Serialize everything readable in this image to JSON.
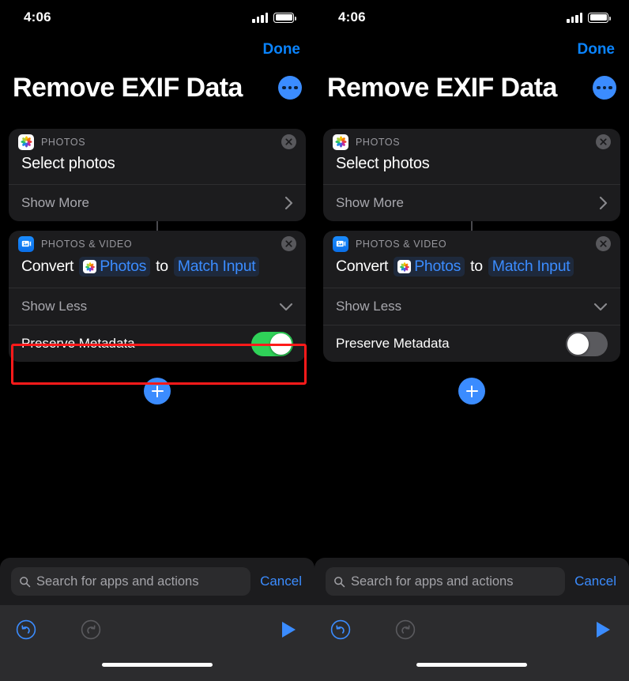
{
  "status_bar": {
    "time": "4:06",
    "signal_icon": "cellular-signal-icon",
    "battery_icon": "battery-full-icon"
  },
  "nav": {
    "done_label": "Done",
    "more_icon": "ellipsis-circle-icon"
  },
  "header": {
    "title": "Remove EXIF Data"
  },
  "colors": {
    "accent_blue": "#3b8cff",
    "link_blue": "#0a84ff",
    "toggle_on_green": "#2fd158",
    "toggle_off_gray": "#5a5a5e",
    "card_bg": "#1c1c1e",
    "toolbar_bg": "#2c2c2e",
    "highlight_red": "#ff1a1a",
    "page_bg": "#000000"
  },
  "actions": [
    {
      "app_label": "PHOTOS",
      "app_icon": "photos-app-icon",
      "title": "Select photos",
      "disclosure_label": "Show More",
      "disclosure_icon": "chevron-right-icon",
      "close_icon": "close-circle-icon"
    },
    {
      "app_label": "PHOTOS & VIDEO",
      "app_icon": "photos-and-video-icon",
      "convert_prefix": "Convert",
      "convert_token": "Photos",
      "convert_token_icon": "photos-app-icon",
      "convert_middle": "to",
      "convert_target_token": "Match Input",
      "disclosure_label": "Show Less",
      "disclosure_icon": "chevron-down-icon",
      "close_icon": "close-circle-icon",
      "parameter_label": "Preserve Metadata"
    }
  ],
  "add_button": {
    "icon": "plus-circle-icon"
  },
  "search": {
    "placeholder": "Search for apps and actions",
    "value": "",
    "icon": "search-icon",
    "cancel_label": "Cancel"
  },
  "toolbar": {
    "undo_icon": "undo-arrow-icon",
    "undo_enabled": "true",
    "redo_icon": "redo-arrow-icon",
    "redo_enabled": "false",
    "play_icon": "play-triangle-icon"
  },
  "panels": {
    "left": {
      "preserve_metadata_state": "on",
      "highlighted": "true"
    },
    "right": {
      "preserve_metadata_state": "off",
      "highlighted": "false"
    }
  }
}
